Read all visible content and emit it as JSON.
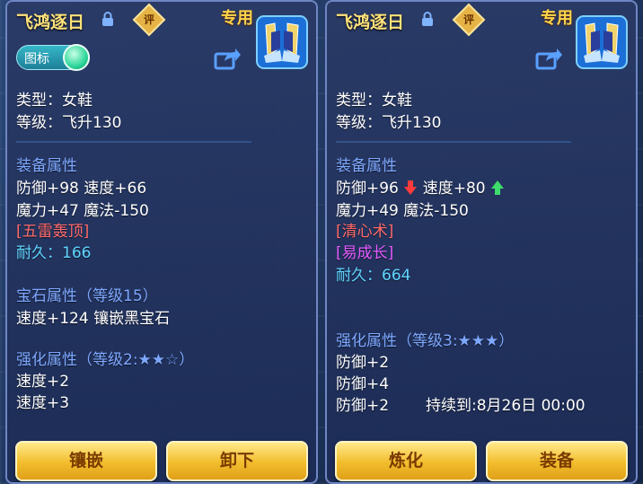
{
  "colors": {
    "title": "#ffe27a",
    "section": "#7ea8ff",
    "special_effect": "#ff6b6b",
    "durability": "#5fd6ff",
    "special_skill": "#e45cff",
    "button": "#f2bd2c"
  },
  "left": {
    "title": "飞鸿逐日",
    "review_badge": "评",
    "special_tag": "专用",
    "toggle_label": "图标",
    "type_line": "类型：女鞋",
    "level_line": "等级：飞升130",
    "equip_section": "装备属性",
    "attr1": "防御+98 速度+66",
    "attr2": "魔力+47 魔法-150",
    "effect": "[五雷轰顶]",
    "durability": "耐久：166",
    "gem_section": "宝石属性（等级15）",
    "gem_line": "速度+124 镶嵌黑宝石",
    "enhance_section": "强化属性（等级2:★★☆）",
    "enhance1": "速度+2",
    "enhance2": "速度+3",
    "btn1": "镶嵌",
    "btn2": "卸下"
  },
  "right": {
    "title": "飞鸿逐日",
    "review_badge": "评",
    "special_tag": "专用",
    "type_line": "类型：女鞋",
    "level_line": "等级：飞升130",
    "equip_section": "装备属性",
    "attr1_a": "防御+96",
    "attr1_b": "速度+80",
    "attr2": "魔力+49 魔法-150",
    "effect": "[清心术]",
    "skill": "[易成长]",
    "durability": "耐久：664",
    "enhance_section": "强化属性（等级3:★★★）",
    "enhance1": "防御+2",
    "enhance2": "防御+4",
    "enhance3": "防御+2",
    "expiry": "持续到:8月26日 00:00",
    "btn1": "炼化",
    "btn2": "装备"
  }
}
